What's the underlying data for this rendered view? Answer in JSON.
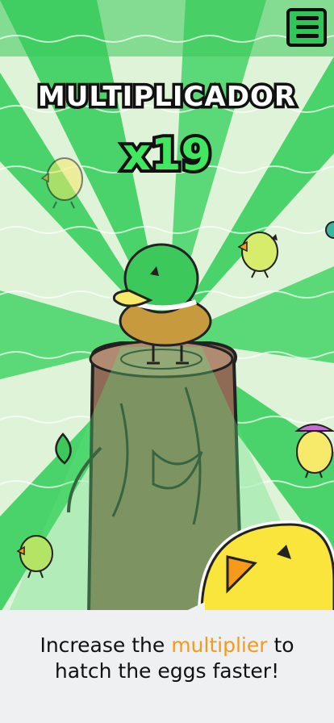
{
  "header": {
    "title": "MULTIPLICADOR",
    "multiplier": "x19"
  },
  "menu": {
    "icon": "hamburger-menu-icon"
  },
  "caption": {
    "before": "Increase the ",
    "highlight": "multiplier",
    "after_line1": " to",
    "line2": "hatch the eggs faster!"
  },
  "colors": {
    "ray_light": "#dff3d9",
    "ray_dark": "#49d36a",
    "stripe_top": "#38c85a",
    "multiplier": "#3fe85e",
    "highlight": "#f59a1b",
    "log": "#8f6a55",
    "duck_green": "#3cc85a",
    "chick_yellow": "#f7e96a"
  }
}
